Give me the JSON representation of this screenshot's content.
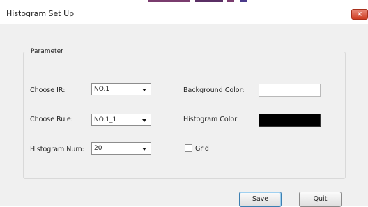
{
  "window": {
    "title": "Histogram Set Up",
    "close_label": "×"
  },
  "group": {
    "label": "Parameter"
  },
  "fields": {
    "choose_ir": {
      "label": "Choose IR:",
      "value": "NO.1"
    },
    "choose_rule": {
      "label": "Choose Rule:",
      "value": "NO.1_1"
    },
    "histogram_num": {
      "label": "Histogram Num:",
      "value": "20"
    },
    "background_color": {
      "label": "Background Color:",
      "color": "#ffffff"
    },
    "histogram_color": {
      "label": "Histogram Color:",
      "color": "#000000"
    },
    "grid": {
      "label": "Grid",
      "checked": false
    }
  },
  "buttons": {
    "save": "Save",
    "quit": "Quit"
  },
  "colors": {
    "dialog_bg": "#f0f0f0",
    "close_button": "#cf3e23"
  }
}
